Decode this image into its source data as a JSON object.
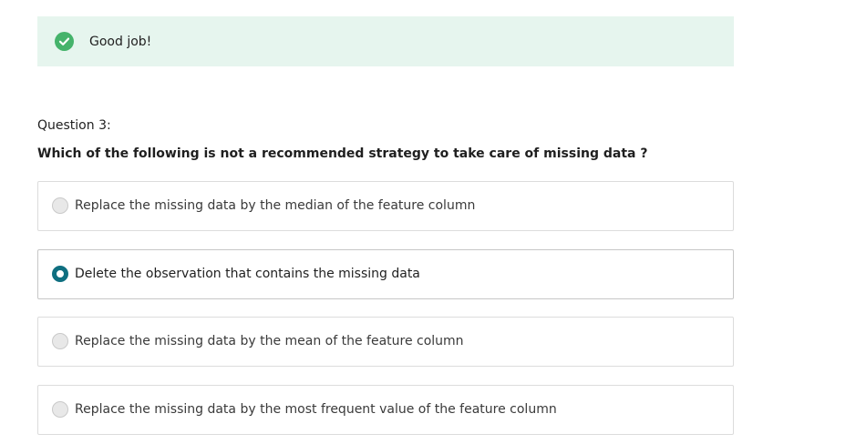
{
  "feedback": {
    "icon": "check-circle-icon",
    "text": "Good job!",
    "status_color": "#45b36b"
  },
  "question": {
    "number": "Question 3:",
    "prompt": "Which of the following is not a recommended strategy to take care of missing data ?",
    "options": [
      {
        "label": "Replace the missing data by the median of the feature column",
        "selected": false
      },
      {
        "label": "Delete the observation that contains the missing data",
        "selected": true
      },
      {
        "label": "Replace the missing data by the mean of the feature column",
        "selected": false
      },
      {
        "label": "Replace the missing data by the most frequent value of the feature column",
        "selected": false
      }
    ]
  },
  "colors": {
    "banner_bg": "#e6f5ee",
    "accent": "#0f6f80"
  }
}
